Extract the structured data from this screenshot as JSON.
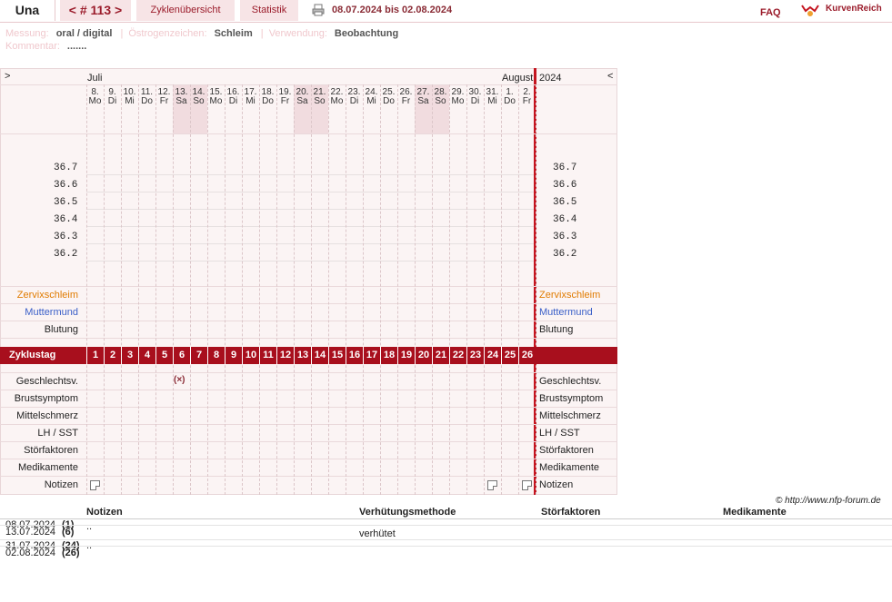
{
  "header": {
    "name": "Una",
    "cycle": "< # 113 >",
    "overview": "Zyklenübersicht",
    "statistics": "Statistik",
    "date_range": "08.07.2024 bis 02.08.2024",
    "faq": "FAQ",
    "logo": "KurvenReich"
  },
  "meta": {
    "measurement_label": "Messung:",
    "measurement_value": "oral / digital",
    "estrogen_label": "Östrogenzeichen:",
    "estrogen_value": "Schleim",
    "usage_label": "Verwendung:",
    "usage_value": "Beobachtung",
    "comment_label": "Kommentar:",
    "comment_value": "......."
  },
  "chart": {
    "nav_left": ">",
    "nav_right": "<",
    "month_july": "Juli",
    "month_august": "August",
    "year": "2024",
    "days": [
      {
        "d": "8.",
        "w": "Mo"
      },
      {
        "d": "9.",
        "w": "Di"
      },
      {
        "d": "10.",
        "w": "Mi"
      },
      {
        "d": "11.",
        "w": "Do"
      },
      {
        "d": "12.",
        "w": "Fr"
      },
      {
        "d": "13.",
        "w": "Sa"
      },
      {
        "d": "14.",
        "w": "So"
      },
      {
        "d": "15.",
        "w": "Mo"
      },
      {
        "d": "16.",
        "w": "Di"
      },
      {
        "d": "17.",
        "w": "Mi"
      },
      {
        "d": "18.",
        "w": "Do"
      },
      {
        "d": "19.",
        "w": "Fr"
      },
      {
        "d": "20.",
        "w": "Sa"
      },
      {
        "d": "21.",
        "w": "So"
      },
      {
        "d": "22.",
        "w": "Mo"
      },
      {
        "d": "23.",
        "w": "Di"
      },
      {
        "d": "24.",
        "w": "Mi"
      },
      {
        "d": "25.",
        "w": "Do"
      },
      {
        "d": "26.",
        "w": "Fr"
      },
      {
        "d": "27.",
        "w": "Sa"
      },
      {
        "d": "28.",
        "w": "So"
      },
      {
        "d": "29.",
        "w": "Mo"
      },
      {
        "d": "30.",
        "w": "Di"
      },
      {
        "d": "31.",
        "w": "Mi"
      },
      {
        "d": "1.",
        "w": "Do"
      },
      {
        "d": "2.",
        "w": "Fr"
      }
    ],
    "temps": [
      "36.7",
      "36.6",
      "36.5",
      "36.4",
      "36.3",
      "36.2"
    ],
    "rows_top": [
      {
        "label": "Zervixschleim",
        "color": "#e07b00"
      },
      {
        "label": "Muttermund",
        "color": "#3a5fc8"
      },
      {
        "label": "Blutung",
        "color": "#222222"
      }
    ],
    "cycle_label": "Zyklustag",
    "cycle_days": [
      "1",
      "2",
      "3",
      "4",
      "5",
      "6",
      "7",
      "8",
      "9",
      "10",
      "11",
      "12",
      "13",
      "14",
      "15",
      "16",
      "17",
      "18",
      "19",
      "20",
      "21",
      "22",
      "23",
      "24",
      "25",
      "26"
    ],
    "rows_bottom": [
      "Geschlechtsv.",
      "Brustsymptom",
      "Mittelschmerz",
      "LH / SST",
      "Störfaktoren",
      "Medikamente",
      "Notizen"
    ],
    "intercourse_mark": "(×)",
    "copyright": "© http://www.nfp-forum.de"
  },
  "table": {
    "headers": [
      "Notizen",
      "Verhütungsmethode",
      "Störfaktoren",
      "Medikamente"
    ],
    "rows": [
      {
        "from": "08.07.2024",
        "from_day": "(1)",
        "to": "13.07.2024",
        "to_day": "(6)",
        "note": "..",
        "method": "verhütet"
      },
      {
        "from": "31.07.2024",
        "from_day": "(24)",
        "to": "02.08.2024",
        "to_day": "(26)",
        "note": "..",
        "method": ""
      }
    ]
  }
}
